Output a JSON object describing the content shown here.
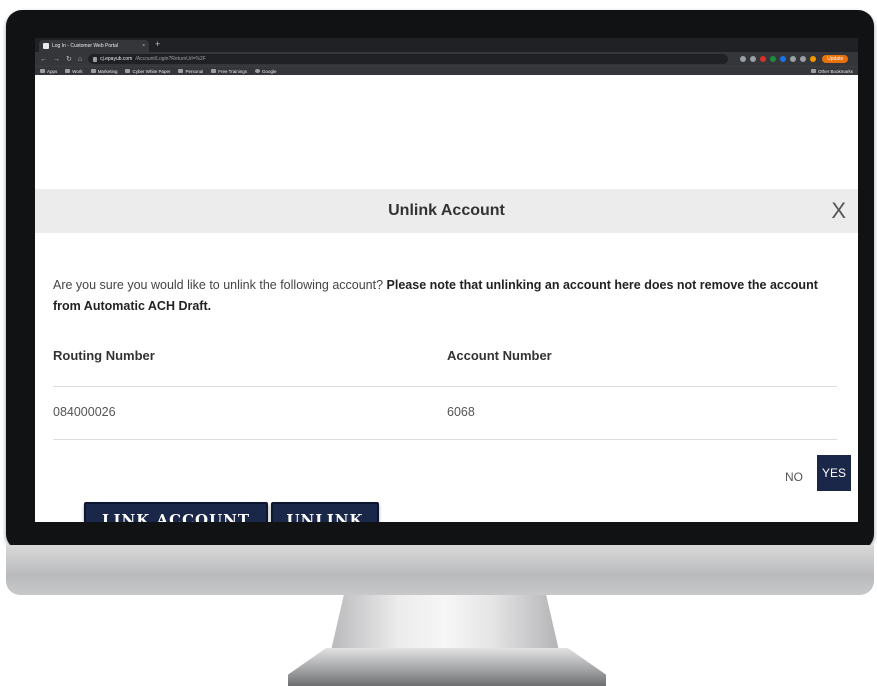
{
  "browser": {
    "tab_title": "Log In - Customer Web Portal",
    "tab_close": "×",
    "new_tab": "+",
    "url_domain": "cj.epayub.com",
    "url_path": "/Account/Login?ReturnUrl=%2F",
    "update_label": "Update",
    "bookmarks": [
      "Apps",
      "Work",
      "Marketing",
      "Cyber White Paper",
      "Personal",
      "Free Trainings",
      "Google"
    ],
    "other_bookmarks": "Other Bookmarks"
  },
  "modal": {
    "title": "Unlink Account",
    "close_label": "X",
    "message_plain": "Are you sure you would like to unlink the following account? ",
    "message_bold": "Please note that unlinking an account here does not remove the account from Automatic ACH Draft.",
    "columns": [
      "Routing Number",
      "Account Number"
    ],
    "row": {
      "routing": "084000026",
      "account": "6068"
    },
    "no_label": "NO",
    "yes_label": "YES"
  },
  "actions": {
    "link_label": "LINK ACCOUNT",
    "unlink_label": "UNLINK"
  },
  "colors": {
    "primary_button": "#1a2748",
    "modal_header": "#ececec"
  }
}
